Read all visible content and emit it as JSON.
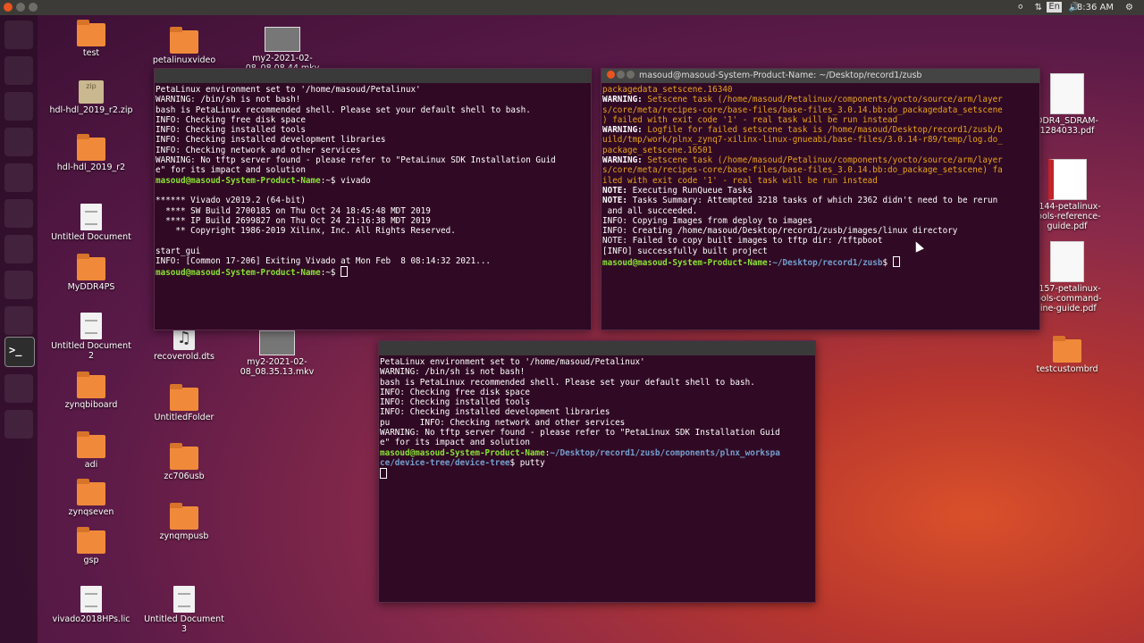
{
  "panel": {
    "clock": "8:36 AM",
    "lang": "En",
    "volume_icon": "volume-icon"
  },
  "desktop_left": [
    {
      "label": "test",
      "kind": "folder"
    },
    {
      "label": "hdl-hdl_2019_r2.zip",
      "kind": "zip",
      "badge": "zip"
    },
    {
      "label": "hdl-hdl_2019_r2",
      "kind": "folder"
    },
    {
      "label": "Untitled Document",
      "kind": "doc"
    },
    {
      "label": "MyDDR4PS",
      "kind": "folder"
    },
    {
      "label": "Untitled Document 2",
      "kind": "doc"
    },
    {
      "label": "zynqbiboard",
      "kind": "folder"
    },
    {
      "label": "adi",
      "kind": "folder"
    },
    {
      "label": "zynqseven",
      "kind": "folder"
    },
    {
      "label": "gsp",
      "kind": "folder"
    },
    {
      "label": "vivado2018HPs.lic",
      "kind": "doc"
    }
  ],
  "desktop_mid": [
    {
      "label": "petalinuxvideo",
      "kind": "folder"
    },
    {
      "label": "my2-2021-02-08_08.08.44.mkv",
      "kind": "video"
    },
    {
      "label": "recoverold.dts",
      "kind": "music"
    },
    {
      "label": "my2-2021-02-08_08.35.13.mkv",
      "kind": "video"
    },
    {
      "label": "UntitledFolder",
      "kind": "folder"
    },
    {
      "label": "zc706usb",
      "kind": "folder"
    },
    {
      "label": "zynqmpusb",
      "kind": "folder"
    },
    {
      "label": "Untitled Document 3",
      "kind": "doc"
    }
  ],
  "desktop_right": [
    {
      "label": "DDR4_SDRAM-1284033.pdf",
      "kind": "pdf"
    },
    {
      "label": "1144-petalinux-tools-reference-guide.pdf",
      "kind": "pdf-red"
    },
    {
      "label": "1157-petalinux-tools-command-line-guide.pdf",
      "kind": "pdf"
    },
    {
      "label": "testcustombrd",
      "kind": "folder"
    }
  ],
  "terminal1": {
    "lines": [
      [
        {
          "t": "PetaLinux environment set to '/home/masoud/Petalinux'",
          "c": ""
        }
      ],
      [
        {
          "t": "WARNING: /bin/sh is not bash!",
          "c": ""
        }
      ],
      [
        {
          "t": "bash is PetaLinux recommended shell. Please set your default shell to bash.",
          "c": ""
        }
      ],
      [
        {
          "t": "INFO: Checking free disk space",
          "c": ""
        }
      ],
      [
        {
          "t": "INFO: Checking installed tools",
          "c": ""
        }
      ],
      [
        {
          "t": "INFO: Checking installed development libraries",
          "c": ""
        }
      ],
      [
        {
          "t": "INFO: Checking network and other services",
          "c": ""
        }
      ],
      [
        {
          "t": "WARNING: No tftp server found - please refer to \"PetaLinux SDK Installation Guid",
          "c": ""
        }
      ],
      [
        {
          "t": "e\" for its impact and solution",
          "c": ""
        }
      ],
      [
        {
          "t": "masoud@masoud-System-Product-Name",
          "c": "g"
        },
        {
          "t": ":~$ vivado",
          "c": ""
        }
      ],
      [
        {
          "t": "",
          "c": ""
        }
      ],
      [
        {
          "t": "****** Vivado v2019.2 (64-bit)",
          "c": ""
        }
      ],
      [
        {
          "t": "  **** SW Build 2700185 on Thu Oct 24 18:45:48 MDT 2019",
          "c": ""
        }
      ],
      [
        {
          "t": "  **** IP Build 2699827 on Thu Oct 24 21:16:38 MDT 2019",
          "c": ""
        }
      ],
      [
        {
          "t": "    ** Copyright 1986-2019 Xilinx, Inc. All Rights Reserved.",
          "c": ""
        }
      ],
      [
        {
          "t": "",
          "c": ""
        }
      ],
      [
        {
          "t": "start_gui",
          "c": ""
        }
      ],
      [
        {
          "t": "INFO: [Common 17-206] Exiting Vivado at Mon Feb  8 08:14:32 2021...",
          "c": ""
        }
      ],
      [
        {
          "t": "masoud@masoud-System-Product-Name",
          "c": "g"
        },
        {
          "t": ":~$ ",
          "c": ""
        },
        {
          "t": "",
          "c": "cursor"
        }
      ]
    ]
  },
  "terminal2": {
    "title": "masoud@masoud-System-Product-Name: ~/Desktop/record1/zusb",
    "lines": [
      [
        {
          "t": "packagedata_setscene.16340",
          "c": "y"
        }
      ],
      [
        {
          "t": "WARNING:",
          "c": "w"
        },
        {
          "t": " Setscene task (/home/masoud/Petalinux/components/yocto/source/arm/layer",
          "c": "y"
        }
      ],
      [
        {
          "t": "s/core/meta/recipes-core/base-files/base-files_3.0.14.bb:do_packagedata_setscene",
          "c": "y"
        }
      ],
      [
        {
          "t": ") failed with exit code '1' - real task will be run instead",
          "c": "y"
        }
      ],
      [
        {
          "t": "WARNING:",
          "c": "w"
        },
        {
          "t": " Logfile for failed setscene task is /home/masoud/Desktop/record1/zusb/b",
          "c": "y"
        }
      ],
      [
        {
          "t": "uild/tmp/work/plnx_zynq7-xilinx-linux-gnueabi/base-files/3.0.14-r89/temp/log.do_",
          "c": "y"
        }
      ],
      [
        {
          "t": "package_setscene.16501",
          "c": "y"
        }
      ],
      [
        {
          "t": "WARNING:",
          "c": "w"
        },
        {
          "t": " Setscene task (/home/masoud/Petalinux/components/yocto/source/arm/layer",
          "c": "y"
        }
      ],
      [
        {
          "t": "s/core/meta/recipes-core/base-files/base-files_3.0.14.bb:do_package_setscene) fa",
          "c": "y"
        }
      ],
      [
        {
          "t": "iled with exit code '1' - real task will be run instead",
          "c": "y"
        }
      ],
      [
        {
          "t": "NOTE:",
          "c": "w"
        },
        {
          "t": " Executing RunQueue Tasks",
          "c": ""
        }
      ],
      [
        {
          "t": "NOTE:",
          "c": "w"
        },
        {
          "t": " Tasks Summary: Attempted 3218 tasks of which 2362 didn't need to be rerun",
          "c": ""
        }
      ],
      [
        {
          "t": " and all succeeded.",
          "c": ""
        }
      ],
      [
        {
          "t": "INFO: Copying Images from deploy to images",
          "c": ""
        }
      ],
      [
        {
          "t": "INFO: Creating /home/masoud/Desktop/record1/zusb/images/linux directory",
          "c": ""
        }
      ],
      [
        {
          "t": "NOTE: Failed to copy built images to tftp dir: /tftpboot",
          "c": ""
        }
      ],
      [
        {
          "t": "[INFO] successfully built project",
          "c": ""
        }
      ],
      [
        {
          "t": "masoud@masoud-System-Product-Name",
          "c": "g"
        },
        {
          "t": ":",
          "c": ""
        },
        {
          "t": "~/Desktop/record1/zusb",
          "c": "b"
        },
        {
          "t": "$ ",
          "c": ""
        },
        {
          "t": "",
          "c": "cursor"
        }
      ]
    ]
  },
  "terminal3": {
    "lines": [
      [
        {
          "t": "PetaLinux environment set to '/home/masoud/Petalinux'",
          "c": ""
        }
      ],
      [
        {
          "t": "WARNING: /bin/sh is not bash!",
          "c": ""
        }
      ],
      [
        {
          "t": "bash is PetaLinux recommended shell. Please set your default shell to bash.",
          "c": ""
        }
      ],
      [
        {
          "t": "INFO: Checking free disk space",
          "c": ""
        }
      ],
      [
        {
          "t": "INFO: Checking installed tools",
          "c": ""
        }
      ],
      [
        {
          "t": "INFO: Checking installed development libraries",
          "c": ""
        }
      ],
      [
        {
          "t": "pu      INFO: Checking network and other services",
          "c": ""
        }
      ],
      [
        {
          "t": "WARNING: No tftp server found - please refer to \"PetaLinux SDK Installation Guid",
          "c": ""
        }
      ],
      [
        {
          "t": "e\" for its impact and solution",
          "c": ""
        }
      ],
      [
        {
          "t": "masoud@masoud-System-Product-Name",
          "c": "g"
        },
        {
          "t": ":",
          "c": ""
        },
        {
          "t": "~/Desktop/record1/zusb/components/plnx_workspa",
          "c": "b"
        }
      ],
      [
        {
          "t": "ce/device-tree/device-tree",
          "c": "b"
        },
        {
          "t": "$ putty",
          "c": ""
        }
      ],
      [
        {
          "t": "",
          "c": "cursor"
        }
      ]
    ]
  }
}
